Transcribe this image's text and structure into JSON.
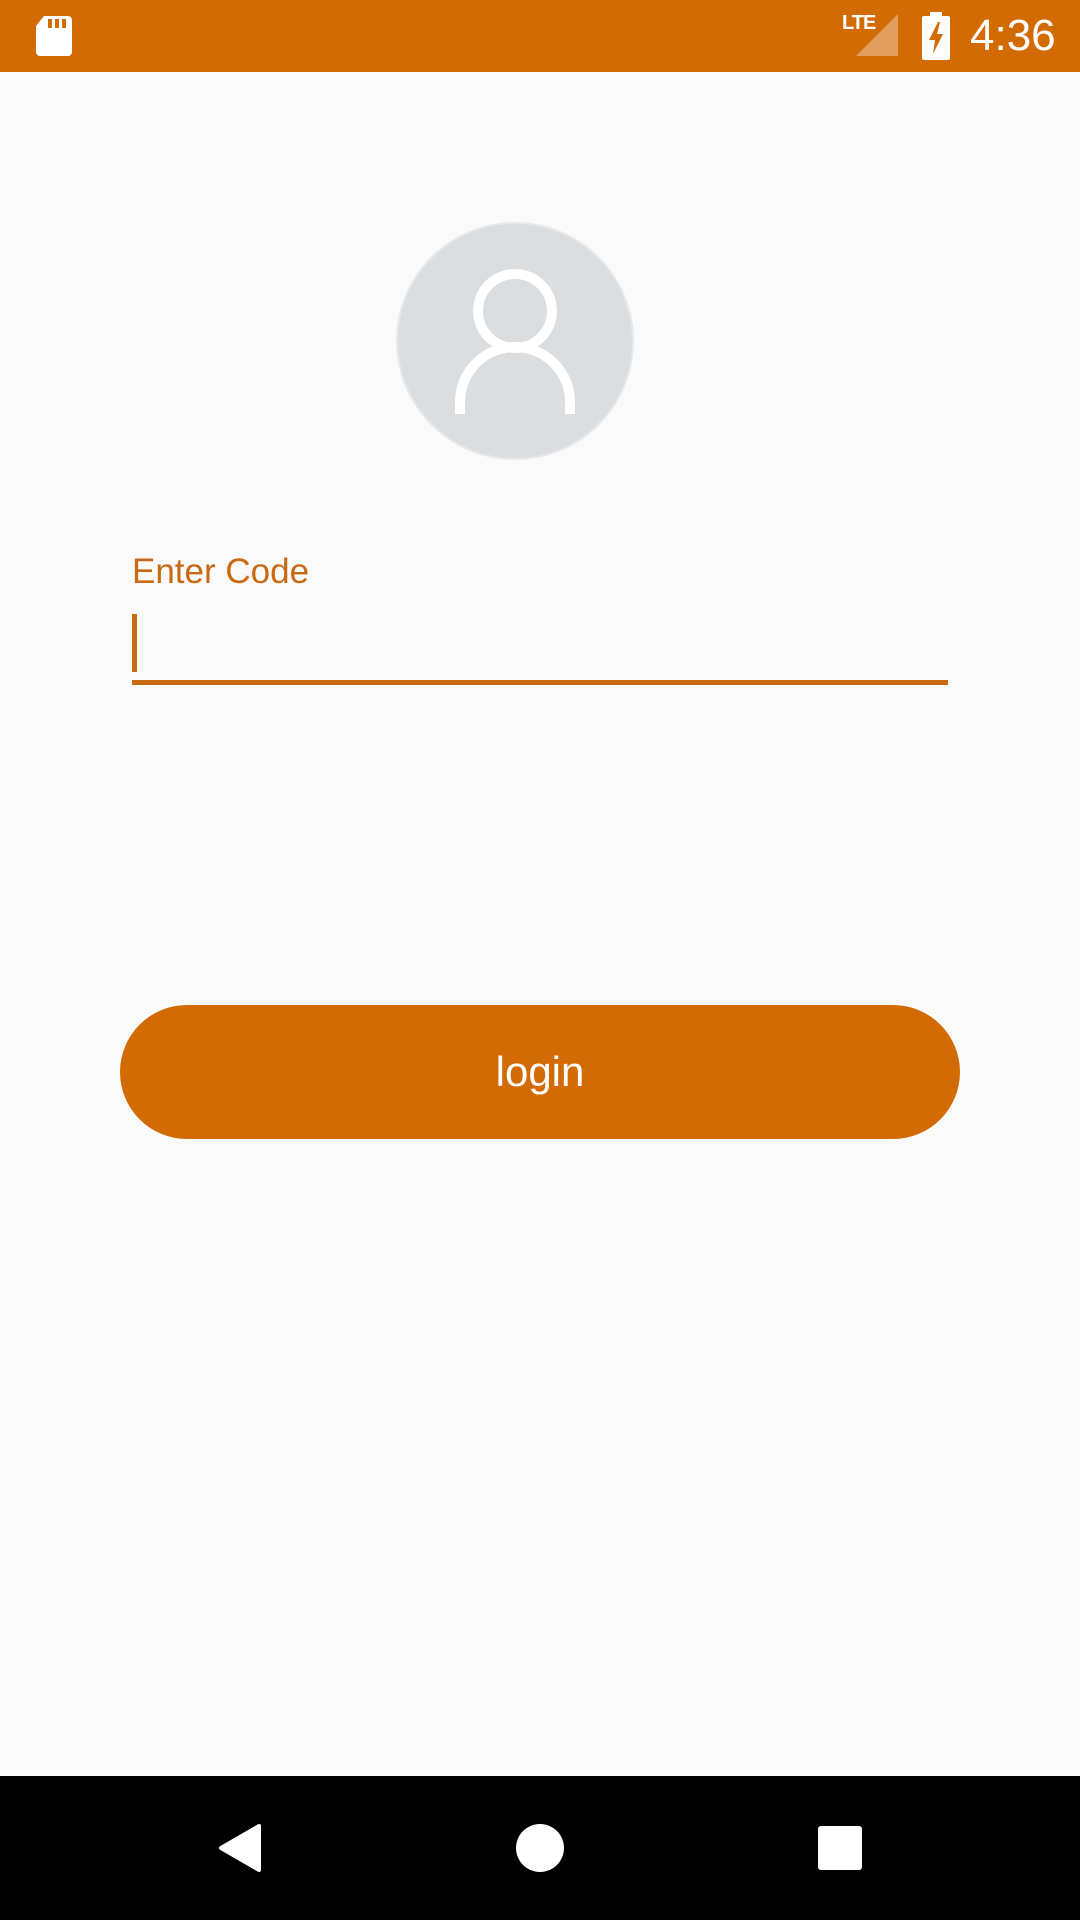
{
  "status_bar": {
    "sd_icon": "sd-card-icon",
    "network_type": "LTE",
    "battery_icon": "battery-charging-icon",
    "time": "4:36",
    "background_color": "#d36b05"
  },
  "avatar": {
    "icon": "user-icon"
  },
  "form": {
    "code_label": "Enter Code",
    "code_value": "",
    "accent_color": "#c96a12"
  },
  "login_button": {
    "label": "login"
  },
  "nav_bar": {
    "back_icon": "back-icon",
    "home_icon": "home-icon",
    "recents_icon": "recents-icon"
  }
}
